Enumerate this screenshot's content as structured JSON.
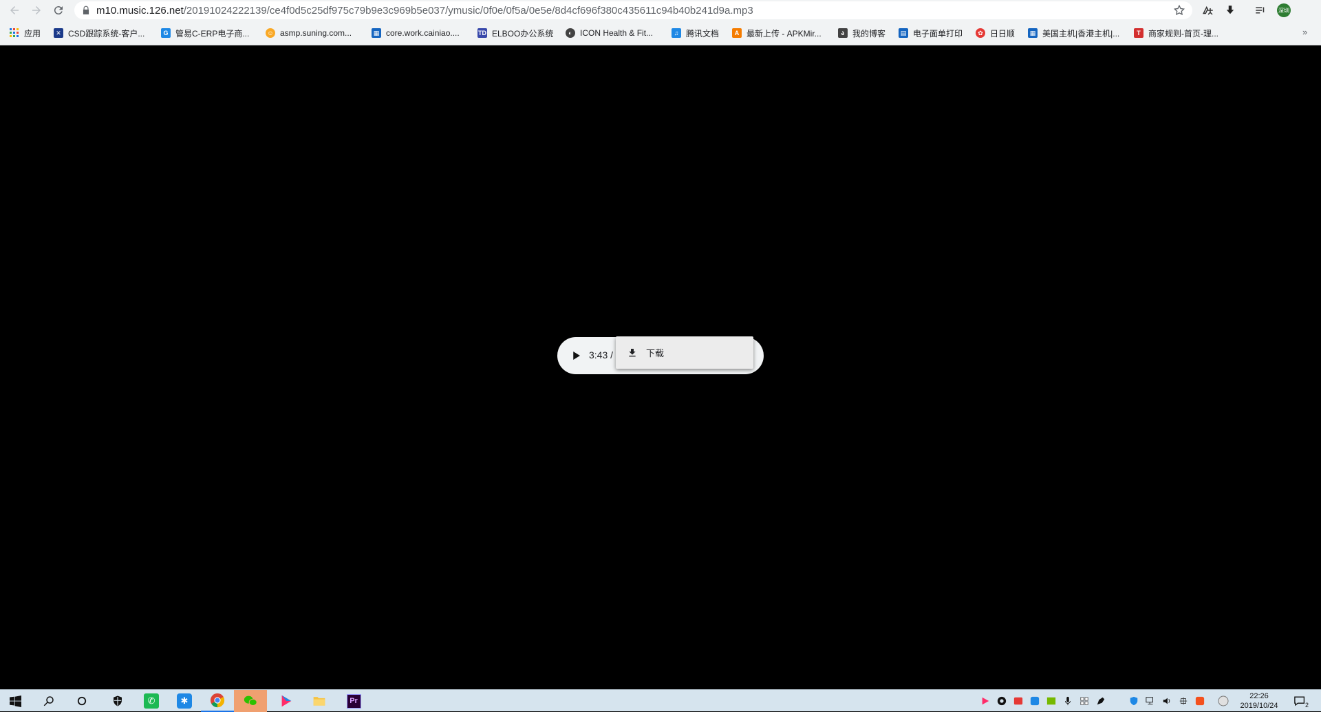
{
  "browser": {
    "url_host": "m10.music.126.net",
    "url_path": "/20191024222139/ce4f0d5c25df975c79b9e3c969b5e037/ymusic/0f0e/0f5a/0e5e/8d4cf696f380c435611c94b40b241d9a.mp3",
    "profile_initials": "深圳"
  },
  "bookmarks": [
    {
      "label": "应用",
      "icon": "apps-grid-icon",
      "color": "#1a73e8"
    },
    {
      "label": "CSD跟踪系统-客户...",
      "icon": "csd-icon",
      "color": "#1b3a8a"
    },
    {
      "label": "管易C-ERP电子商...",
      "icon": "guanyi-icon",
      "color": "#1e88e5"
    },
    {
      "label": "asmp.suning.com...",
      "icon": "suning-icon",
      "color": "#f9a825"
    },
    {
      "label": "core.work.cainiao....",
      "icon": "cainiao-icon",
      "color": "#1565c0"
    },
    {
      "label": "ELBOO办公系统",
      "icon": "td-icon",
      "color": "#3949ab"
    },
    {
      "label": "ICON Health & Fit...",
      "icon": "icon-health-icon",
      "color": "#424242"
    },
    {
      "label": "腾讯文档",
      "icon": "tencent-docs-icon",
      "color": "#1e88e5"
    },
    {
      "label": "最新上传 - APKMir...",
      "icon": "apkmirror-icon",
      "color": "#f57c00"
    },
    {
      "label": "我的博客",
      "icon": "blog-icon",
      "color": "#424242"
    },
    {
      "label": "电子面单打印",
      "icon": "print-icon",
      "color": "#1565c0"
    },
    {
      "label": "日日顺",
      "icon": "rrs-icon",
      "color": "#e53935"
    },
    {
      "label": "美国主机|香港主机|...",
      "icon": "host-icon",
      "color": "#1565c0"
    },
    {
      "label": "商家规则-首页-理...",
      "icon": "tmall-icon",
      "color": "#d32f2f"
    }
  ],
  "player": {
    "time_text": "3:43 /",
    "menu_item": "下载"
  },
  "taskbar": {
    "time": "22:26",
    "date": "2019/10/24",
    "notification_count": "2"
  }
}
